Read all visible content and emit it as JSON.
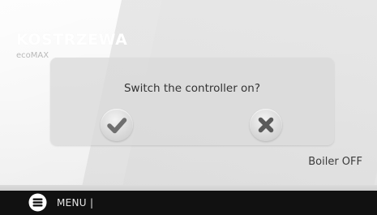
{
  "header": {
    "brand": "KOSTRZEWA",
    "model": "ecoMAX"
  },
  "dialog": {
    "question": "Switch the controller on?",
    "confirm_icon": "check-icon",
    "cancel_icon": "close-icon"
  },
  "status": {
    "text": "Boiler OFF"
  },
  "bottom_bar": {
    "menu_icon": "menu-icon",
    "menu_label": "MENU |"
  }
}
